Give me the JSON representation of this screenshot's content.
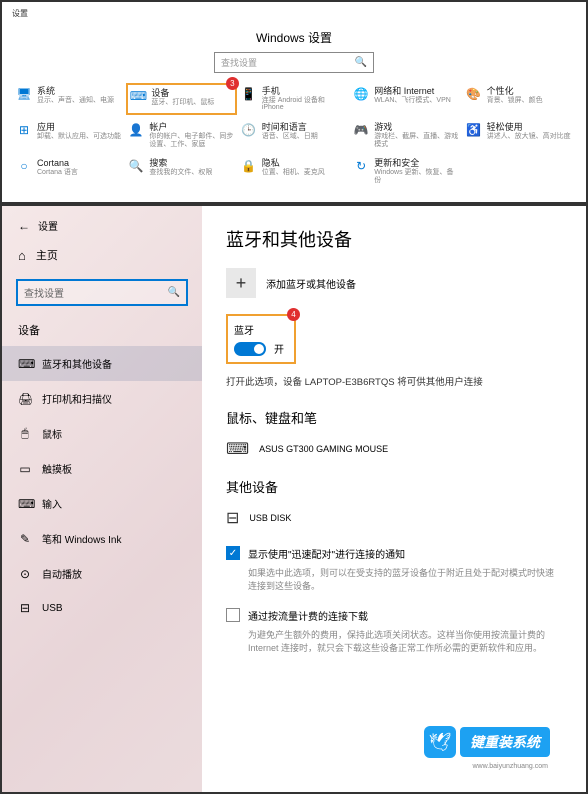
{
  "top": {
    "header": "设置",
    "title": "Windows 设置",
    "search_placeholder": "查找设置",
    "badge3": "3",
    "items": [
      {
        "icon": "🖥",
        "title": "系统",
        "sub": "显示、声音、通知、电源"
      },
      {
        "icon": "⌨",
        "title": "设备",
        "sub": "蓝牙、打印机、鼠标"
      },
      {
        "icon": "📱",
        "title": "手机",
        "sub": "连接 Android 设备和 iPhone"
      },
      {
        "icon": "🌐",
        "title": "网络和 Internet",
        "sub": "WLAN、飞行模式、VPN"
      },
      {
        "icon": "🎨",
        "title": "个性化",
        "sub": "背景、锁屏、颜色"
      },
      {
        "icon": "⊞",
        "title": "应用",
        "sub": "卸载、默认应用、可选功能"
      },
      {
        "icon": "👤",
        "title": "帐户",
        "sub": "你的帐户、电子邮件、同步设置、工作、家庭"
      },
      {
        "icon": "🕒",
        "title": "时间和语言",
        "sub": "语音、区域、日期"
      },
      {
        "icon": "🎮",
        "title": "游戏",
        "sub": "游戏栏、截屏、直播、游戏模式"
      },
      {
        "icon": "♿",
        "title": "轻松使用",
        "sub": "讲述人、放大镜、高对比度"
      },
      {
        "icon": "○",
        "title": "Cortana",
        "sub": "Cortana 语言"
      },
      {
        "icon": "🔍",
        "title": "搜索",
        "sub": "查找我的文件、权限"
      },
      {
        "icon": "🔒",
        "title": "隐私",
        "sub": "位置、相机、麦克风"
      },
      {
        "icon": "↻",
        "title": "更新和安全",
        "sub": "Windows 更新、恢复、备份"
      }
    ]
  },
  "bottom": {
    "header": "设置",
    "home": "主页",
    "search_placeholder": "查找设置",
    "section": "设备",
    "nav": [
      {
        "icon": "⌨",
        "label": "蓝牙和其他设备"
      },
      {
        "icon": "🖨",
        "label": "打印机和扫描仪"
      },
      {
        "icon": "🖱",
        "label": "鼠标"
      },
      {
        "icon": "▭",
        "label": "触摸板"
      },
      {
        "icon": "⌨",
        "label": "输入"
      },
      {
        "icon": "✎",
        "label": "笔和 Windows Ink"
      },
      {
        "icon": "⊙",
        "label": "自动播放"
      },
      {
        "icon": "⊟",
        "label": "USB"
      }
    ],
    "content": {
      "title": "蓝牙和其他设备",
      "add_label": "添加蓝牙或其他设备",
      "badge4": "4",
      "bt_label": "蓝牙",
      "bt_state": "开",
      "bt_desc": "打开此选项，设备 LAPTOP-E3B6RTQS 将可供其他用户连接",
      "section1": "鼠标、键盘和笔",
      "device1": "ASUS GT300 GAMING MOUSE",
      "section2": "其他设备",
      "device2": "USB DISK",
      "check1_label": "显示使用\"迅速配对\"进行连接的通知",
      "check1_desc": "如果选中此选项，则可以在受支持的蓝牙设备位于附近且处于配对模式时快速连接到这些设备。",
      "check2_label": "通过按流量计费的连接下载",
      "check2_desc": "为避免产生额外的费用，保持此选项关闭状态。这样当你使用按流量计费的 Internet 连接时，就只会下载这些设备正常工作所必需的更新软件和应用。"
    },
    "watermark": "键重装系统",
    "watermark_sub": "www.baiyunzhuang.com"
  }
}
